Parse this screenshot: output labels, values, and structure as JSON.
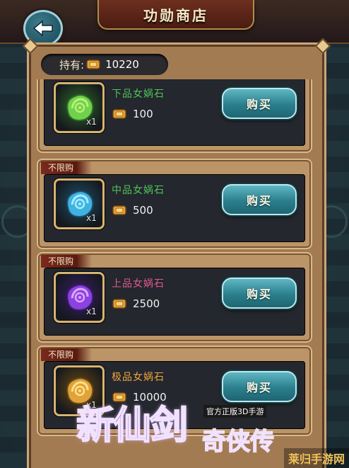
{
  "header": {
    "title": "功勋商店"
  },
  "holding": {
    "label": "持有:",
    "amount": "10220"
  },
  "items": [
    {
      "tag": "",
      "name": "下品女娲石",
      "name_color": "#4fc25a",
      "price": "100",
      "qty": "x1",
      "gem": "green",
      "buy": "购买"
    },
    {
      "tag": "不限购",
      "name": "中品女娲石",
      "name_color": "#4fc25a",
      "price": "500",
      "qty": "x1",
      "gem": "blue",
      "buy": "购买"
    },
    {
      "tag": "不限购",
      "name": "上品女娲石",
      "name_color": "#e05a8a",
      "price": "2500",
      "qty": "x1",
      "gem": "purple",
      "buy": "购买"
    },
    {
      "tag": "不限购",
      "name": "极品女娲石",
      "name_color": "#f0a43c",
      "price": "10000",
      "qty": "x1",
      "gem": "gold",
      "buy": "购买"
    }
  ],
  "watermark": {
    "game_logo": "新仙剑",
    "logo_sub": "官方正版3D手游",
    "logo_tail": "奇侠传",
    "site": "莱归手游网"
  },
  "colors": {
    "frame": "#a37b52",
    "buy_button": "#2b7f8d",
    "panel": "#24272d"
  }
}
